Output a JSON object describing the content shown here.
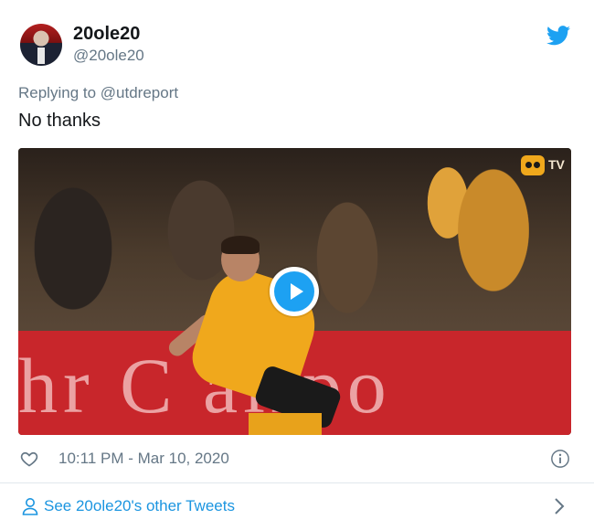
{
  "tweet": {
    "author_name": "20ole20",
    "author_handle": "@20ole20",
    "reply_prefix": "Replying to",
    "reply_to": "@utdreport",
    "text": "No thanks",
    "timestamp": "10:11 PM - Mar 10, 2020",
    "media": {
      "type": "video",
      "overlay_badge": "TV",
      "board_text": "hr C airpo"
    }
  },
  "footer": {
    "other_tweets_label": "See 20ole20's other Tweets"
  },
  "icons": {
    "brand": "twitter-bird-icon",
    "like": "heart-icon",
    "info": "info-icon",
    "person": "person-icon",
    "chevron": "chevron-right-icon",
    "play": "play-icon"
  },
  "colors": {
    "brand_blue": "#1da1f2",
    "link_blue": "#1b95e0",
    "secondary_text": "#657786",
    "primary_text": "#14171a",
    "divider": "#e1e8ed"
  }
}
